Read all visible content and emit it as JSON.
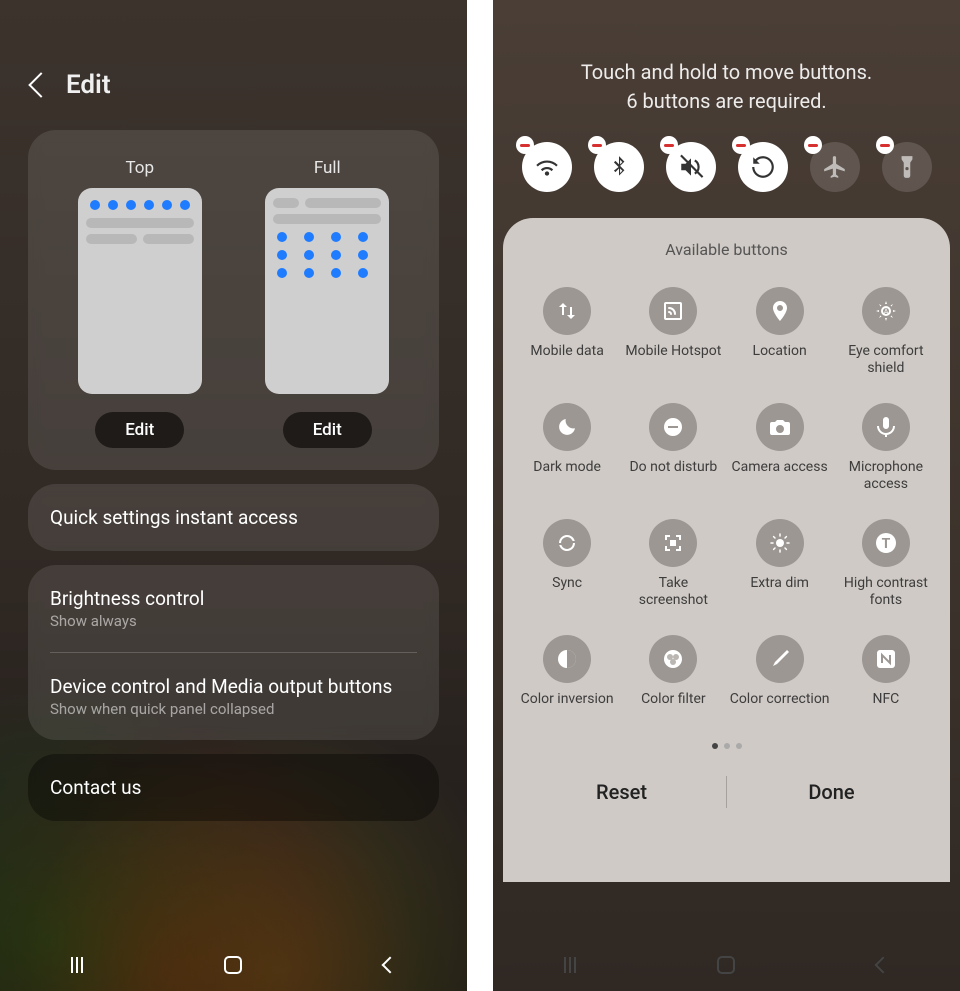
{
  "left": {
    "title": "Edit",
    "preview_top_label": "Top",
    "preview_full_label": "Full",
    "edit_btn": "Edit",
    "quick_access": "Quick settings instant access",
    "brightness_title": "Brightness control",
    "brightness_sub": "Show always",
    "device_title": "Device control and Media output buttons",
    "device_sub": "Show when quick panel collapsed",
    "contact": "Contact us"
  },
  "right": {
    "hint_line1": "Touch and hold to move buttons.",
    "hint_line2": "6 buttons are required.",
    "toggles": [
      {
        "name": "wifi",
        "icon": "wifi",
        "active": true
      },
      {
        "name": "bluetooth",
        "icon": "bluetooth",
        "active": true
      },
      {
        "name": "sound",
        "icon": "mute",
        "active": true
      },
      {
        "name": "rotate",
        "icon": "rotate",
        "active": true
      },
      {
        "name": "airplane",
        "icon": "airplane",
        "active": false
      },
      {
        "name": "flashlight",
        "icon": "flashlight",
        "active": false
      }
    ],
    "available_title": "Available buttons",
    "available": [
      {
        "label": "Mobile data",
        "icon": "mobiledata"
      },
      {
        "label": "Mobile Hotspot",
        "icon": "hotspot"
      },
      {
        "label": "Location",
        "icon": "location"
      },
      {
        "label": "Eye comfort shield",
        "icon": "eyecomfort"
      },
      {
        "label": "Dark mode",
        "icon": "darkmode"
      },
      {
        "label": "Do not disturb",
        "icon": "dnd"
      },
      {
        "label": "Camera access",
        "icon": "camera"
      },
      {
        "label": "Microphone access",
        "icon": "mic"
      },
      {
        "label": "Sync",
        "icon": "sync"
      },
      {
        "label": "Take screenshot",
        "icon": "screenshot"
      },
      {
        "label": "Extra dim",
        "icon": "extradim"
      },
      {
        "label": "High contrast fonts",
        "icon": "highcontrast"
      },
      {
        "label": "Color inversion",
        "icon": "inversion"
      },
      {
        "label": "Color filter",
        "icon": "colorfilter"
      },
      {
        "label": "Color correction",
        "icon": "colorcorrection"
      },
      {
        "label": "NFC",
        "icon": "nfc"
      }
    ],
    "page_count": 3,
    "page_active": 0,
    "reset": "Reset",
    "done": "Done"
  }
}
